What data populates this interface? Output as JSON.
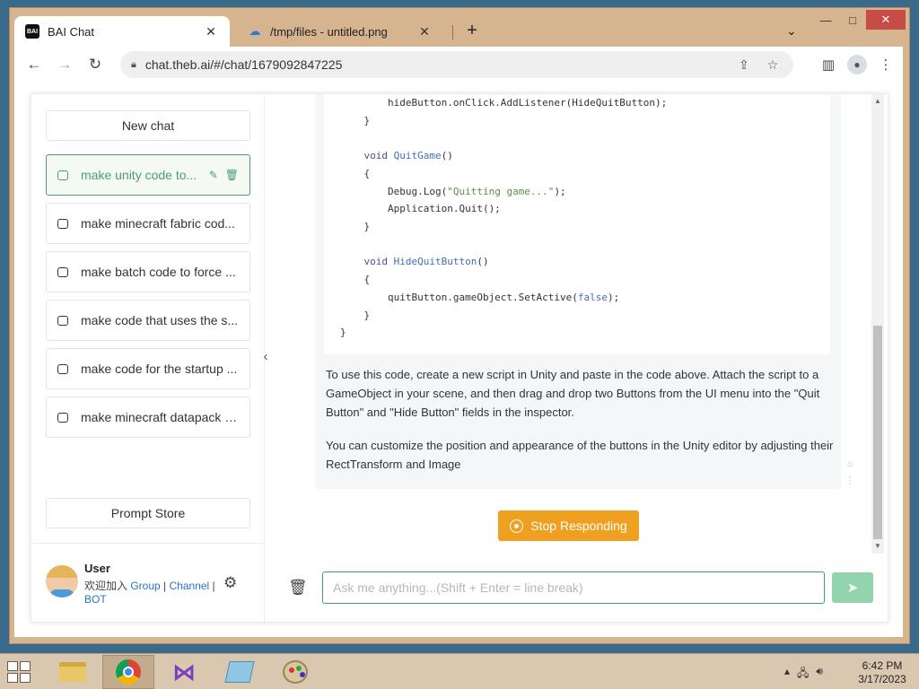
{
  "window": {
    "minimize": "—",
    "maximize": "□",
    "close": "✕"
  },
  "tabs": [
    {
      "favicon": "BAI",
      "title": "BAI Chat",
      "close": "✕"
    },
    {
      "favicon": "cloud-icon",
      "title": "/tmp/files - untitled.png",
      "close": "✕"
    }
  ],
  "newtab": "+",
  "tab_menu": "⌄",
  "toolbar": {
    "back": "←",
    "forward": "→",
    "reload": "↻",
    "url": "chat.theb.ai/#/chat/1679092847225"
  },
  "sidebar": {
    "new_chat": "New chat",
    "items": [
      {
        "label": "make unity code to..."
      },
      {
        "label": "make minecraft fabric cod..."
      },
      {
        "label": "make batch code to force ..."
      },
      {
        "label": "make code that uses the s..."
      },
      {
        "label": "make code for the startup ..."
      },
      {
        "label": "make minecraft datapack c..."
      }
    ],
    "prompt_store": "Prompt Store",
    "user": {
      "name": "User",
      "desc_prefix": "欢迎加入 ",
      "link_group": "Group",
      "sep1": " | ",
      "link_channel": "Channel",
      "sep2": " | ",
      "link_bot": "BOT"
    }
  },
  "code": {
    "line1": "        hideButton.onClick.AddListener(HideQuitButton);",
    "line2": "    }",
    "line3_kw": "    void ",
    "line3_fn": "QuitGame",
    "line3_end": "()",
    "line4": "    {",
    "line5_a": "        Debug.Log(",
    "line5_str": "\"Quitting game...\"",
    "line5_b": ");",
    "line6": "        Application.Quit();",
    "line7": "    }",
    "line8_kw": "    void ",
    "line8_fn": "HideQuitButton",
    "line8_end": "()",
    "line9": "    {",
    "line10_a": "        quitButton.gameObject.SetActive(",
    "line10_kw": "false",
    "line10_b": ");",
    "line11": "    }",
    "line12": "}"
  },
  "message": {
    "para1": "To use this code, create a new script in Unity and paste in the code above. Attach the script to a GameObject in your scene, and then drag and drop two Buttons from the UI menu into the \"Quit Button\" and \"Hide Button\" fields in the inspector.",
    "para2": "You can customize the position and appearance of the buttons in the Unity editor by adjusting their RectTransform and Image"
  },
  "stop_button": "Stop Responding",
  "input": {
    "placeholder": "Ask me anything...(Shift + Enter = line break)",
    "value": ""
  },
  "taskbar": {
    "time": "6:42 PM",
    "date": "3/17/2023"
  },
  "colors": {
    "accent": "#4b9e6f",
    "stop": "#f0a020",
    "send": "#92d4ae",
    "link": "#2a72c9"
  }
}
